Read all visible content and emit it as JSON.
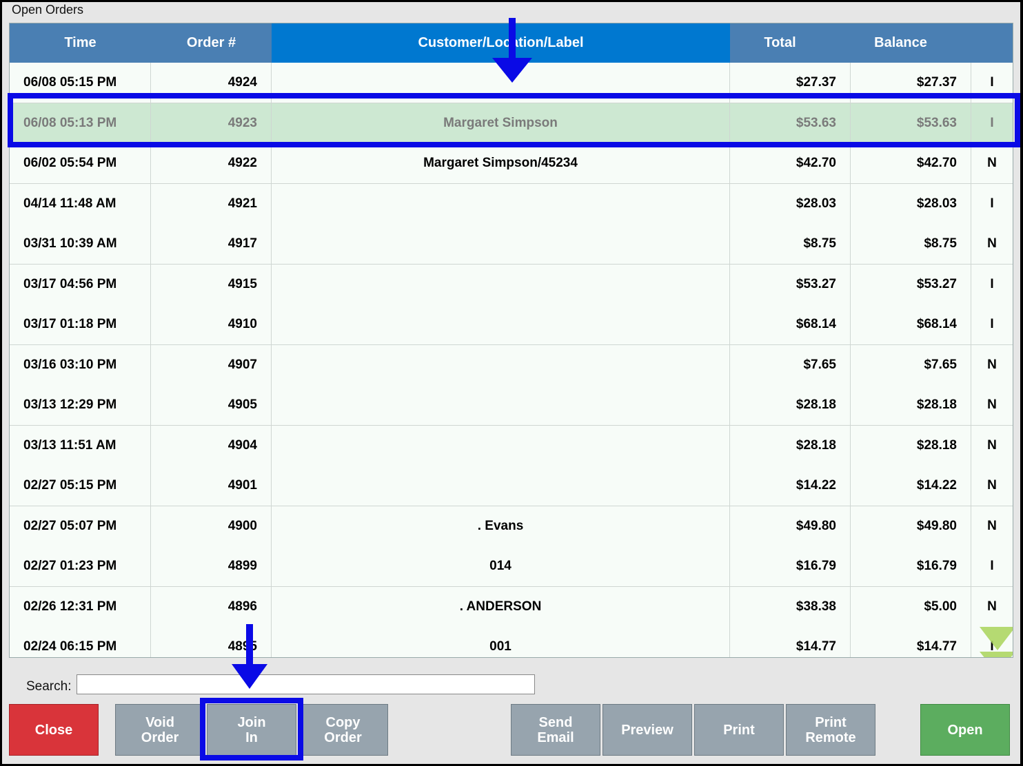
{
  "window": {
    "title": "Open Orders"
  },
  "columns": [
    "Time",
    "Order #",
    "Customer/Location/Label",
    "Total",
    "Balance",
    ""
  ],
  "rows": [
    {
      "time": "06/08 05:15 PM",
      "order": "4924",
      "customer": "",
      "total": "$27.37",
      "balance": "$27.37",
      "type": "I"
    },
    {
      "time": "06/08 05:13 PM",
      "order": "4923",
      "customer": "Margaret Simpson",
      "total": "$53.63",
      "balance": "$53.63",
      "type": "I"
    },
    {
      "time": "06/02 05:54 PM",
      "order": "4922",
      "customer": "Margaret Simpson/45234",
      "total": "$42.70",
      "balance": "$42.70",
      "type": "N"
    },
    {
      "time": "04/14 11:48 AM",
      "order": "4921",
      "customer": "",
      "total": "$28.03",
      "balance": "$28.03",
      "type": "I"
    },
    {
      "time": "03/31 10:39 AM",
      "order": "4917",
      "customer": "",
      "total": "$8.75",
      "balance": "$8.75",
      "type": "N"
    },
    {
      "time": "03/17 04:56 PM",
      "order": "4915",
      "customer": "",
      "total": "$53.27",
      "balance": "$53.27",
      "type": "I"
    },
    {
      "time": "03/17 01:18 PM",
      "order": "4910",
      "customer": "",
      "total": "$68.14",
      "balance": "$68.14",
      "type": "I"
    },
    {
      "time": "03/16 03:10 PM",
      "order": "4907",
      "customer": "",
      "total": "$7.65",
      "balance": "$7.65",
      "type": "N"
    },
    {
      "time": "03/13 12:29 PM",
      "order": "4905",
      "customer": "",
      "total": "$28.18",
      "balance": "$28.18",
      "type": "N"
    },
    {
      "time": "03/13 11:51 AM",
      "order": "4904",
      "customer": "",
      "total": "$28.18",
      "balance": "$28.18",
      "type": "N"
    },
    {
      "time": "02/27 05:15 PM",
      "order": "4901",
      "customer": "",
      "total": "$14.22",
      "balance": "$14.22",
      "type": "N"
    },
    {
      "time": "02/27 05:07 PM",
      "order": "4900",
      "customer": ". Evans",
      "total": "$49.80",
      "balance": "$49.80",
      "type": "N"
    },
    {
      "time": "02/27 01:23 PM",
      "order": "4899",
      "customer": "014",
      "total": "$16.79",
      "balance": "$16.79",
      "type": "I"
    },
    {
      "time": "02/26 12:31 PM",
      "order": "4896",
      "customer": ". ANDERSON",
      "total": "$38.38",
      "balance": "$5.00",
      "type": "N"
    },
    {
      "time": "02/24 06:15 PM",
      "order": "4895",
      "customer": "001",
      "total": "$14.77",
      "balance": "$14.77",
      "type": "I"
    }
  ],
  "selected_row_index": 1,
  "search": {
    "label": "Search:",
    "value": ""
  },
  "buttons": {
    "close": "Close",
    "void_order": "Void\nOrder",
    "join_in": "Join\nIn",
    "copy_order": "Copy\nOrder",
    "send_email": "Send\nEmail",
    "preview": "Preview",
    "print": "Print",
    "print_remote": "Print\nRemote",
    "open": "Open"
  },
  "colors": {
    "header": "#4a7fb3",
    "header_active": "#0078d0",
    "selected_row": "#cde8d2",
    "close": "#d9343a",
    "open": "#5cad5f",
    "button": "#97a4ae",
    "annotation": "#0a0ae6",
    "scroll_arrow": "#a9d45a"
  },
  "icons": {
    "scroll": "double-chevron-down-icon",
    "annotation": "arrow-down-icon"
  }
}
